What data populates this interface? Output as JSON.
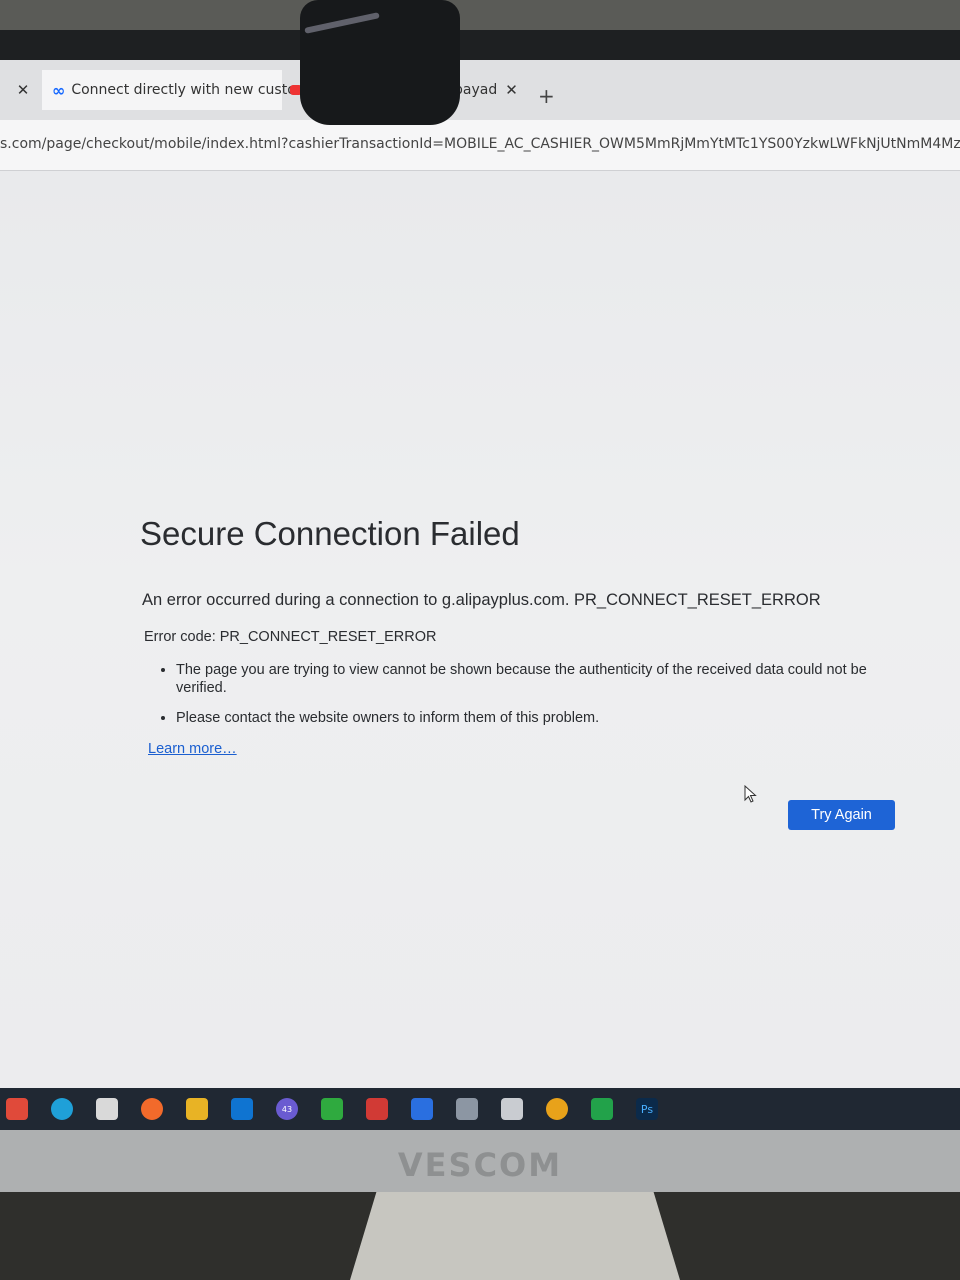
{
  "browser": {
    "tabs": [
      {
        "label": "",
        "close": "✕"
      },
      {
        "label": "Connect directly with new custo",
        "close": "✕"
      },
      {
        "label": ""
      },
      {
        "label": "bayad",
        "close": "✕"
      }
    ],
    "new_tab": "+",
    "url": "s.com/page/checkout/mobile/index.html?cashierTransactionId=MOBILE_AC_CASHIER_OWM5MmRjMmYtMTc1YS00YzkwLWFkNjUtNmM4MzlmNDA4"
  },
  "error": {
    "title": "Secure Connection Failed",
    "description": "An error occurred during a connection to g.alipayplus.com. PR_CONNECT_RESET_ERROR",
    "code_line": "Error code: PR_CONNECT_RESET_ERROR",
    "bullets": [
      "The page you are trying to view cannot be shown because the authenticity of the received data could not be verified.",
      "Please contact the website owners to inform them of this problem."
    ],
    "learn_more": "Learn more…",
    "try_again": "Try Again"
  },
  "taskbar": {
    "icons": [
      "windows-start-icon",
      "edge-icon",
      "calendar-icon",
      "firefox-icon",
      "file-explorer-icon",
      "outlook-icon",
      "chat-icon",
      "green-app-icon",
      "red-app-icon",
      "blue-app-icon",
      "gray-app-icon",
      "widget-icon",
      "chrome-icon",
      "green-app-2-icon",
      "photoshop-icon"
    ],
    "badge": "43",
    "ps_label": "Ps"
  },
  "monitor": {
    "brand": "VESCOM"
  }
}
